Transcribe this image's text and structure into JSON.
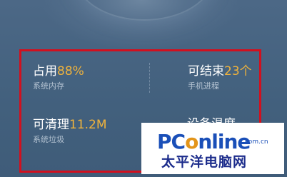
{
  "stats": {
    "memory": {
      "label": "占用",
      "value": "88%",
      "sub": "系统内存"
    },
    "processes": {
      "label": "可结束",
      "value": "23个",
      "sub": "手机进程"
    },
    "junk": {
      "label": "可清理",
      "value": "11.2M",
      "sub": "系统垃圾"
    },
    "partial": {
      "label": "设备温度"
    }
  },
  "watermark": {
    "logo_part1": "PC",
    "logo_o": "o",
    "logo_part2": "nline",
    "domain_suffix": ".com.cn",
    "sub": "太平洋电脑网"
  },
  "colors": {
    "accent": "#f0b33c",
    "highlight_border": "#d2101e",
    "background": "#45617d"
  }
}
